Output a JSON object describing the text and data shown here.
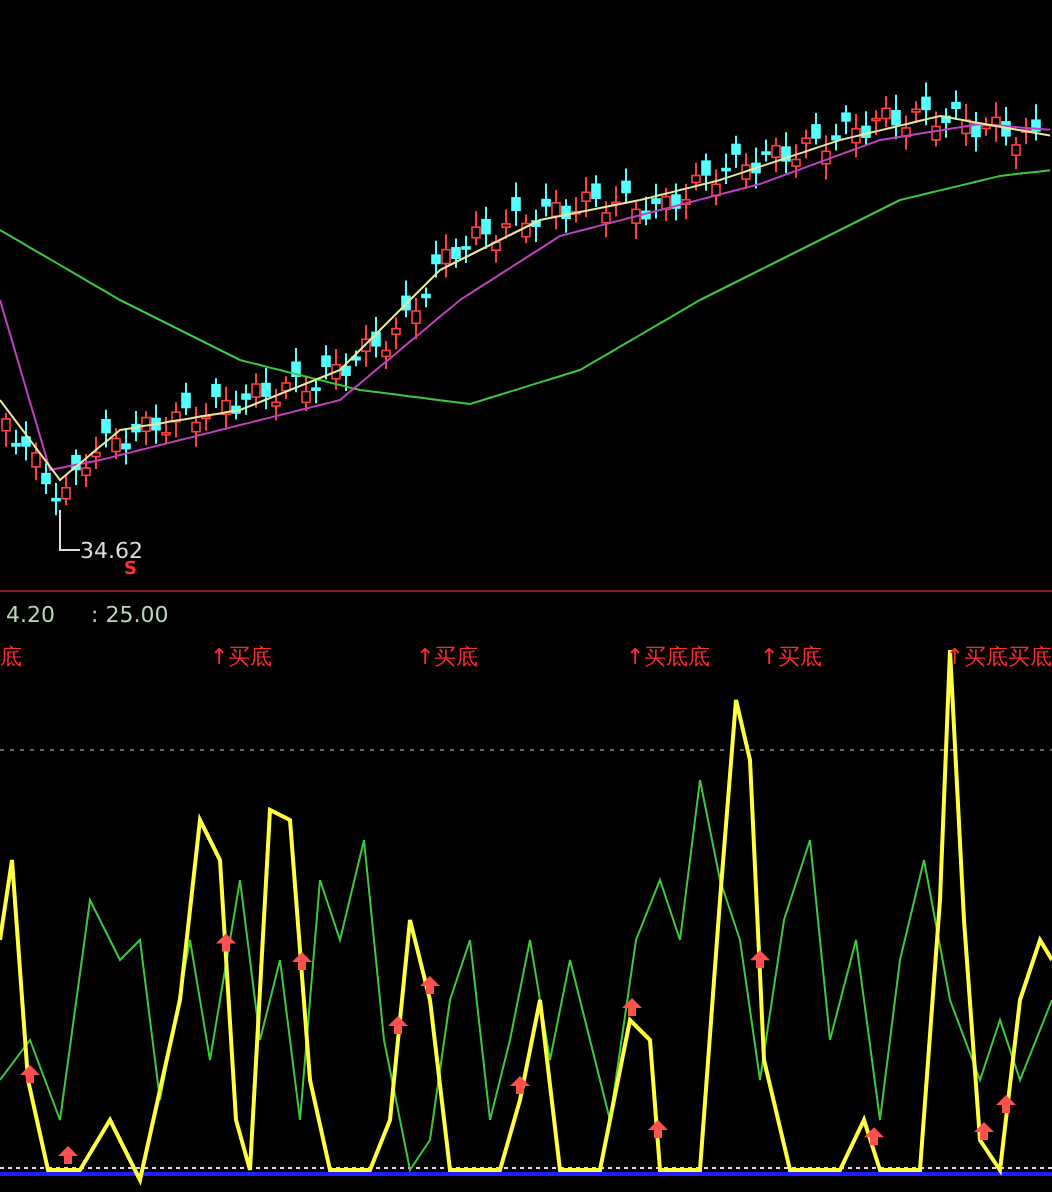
{
  "price_panel": {
    "low_label": "34.62",
    "marker": "S"
  },
  "indicator_header": {
    "values": [
      "4.20",
      ": 25.00"
    ]
  },
  "indicator_panel": {
    "signals": [
      {
        "label": "底"
      },
      {
        "label": "↑买底"
      },
      {
        "label": "↑买底"
      },
      {
        "label": "↑买底底"
      },
      {
        "label": "↑买底"
      },
      {
        "label": "↑买底买底"
      }
    ]
  }
}
